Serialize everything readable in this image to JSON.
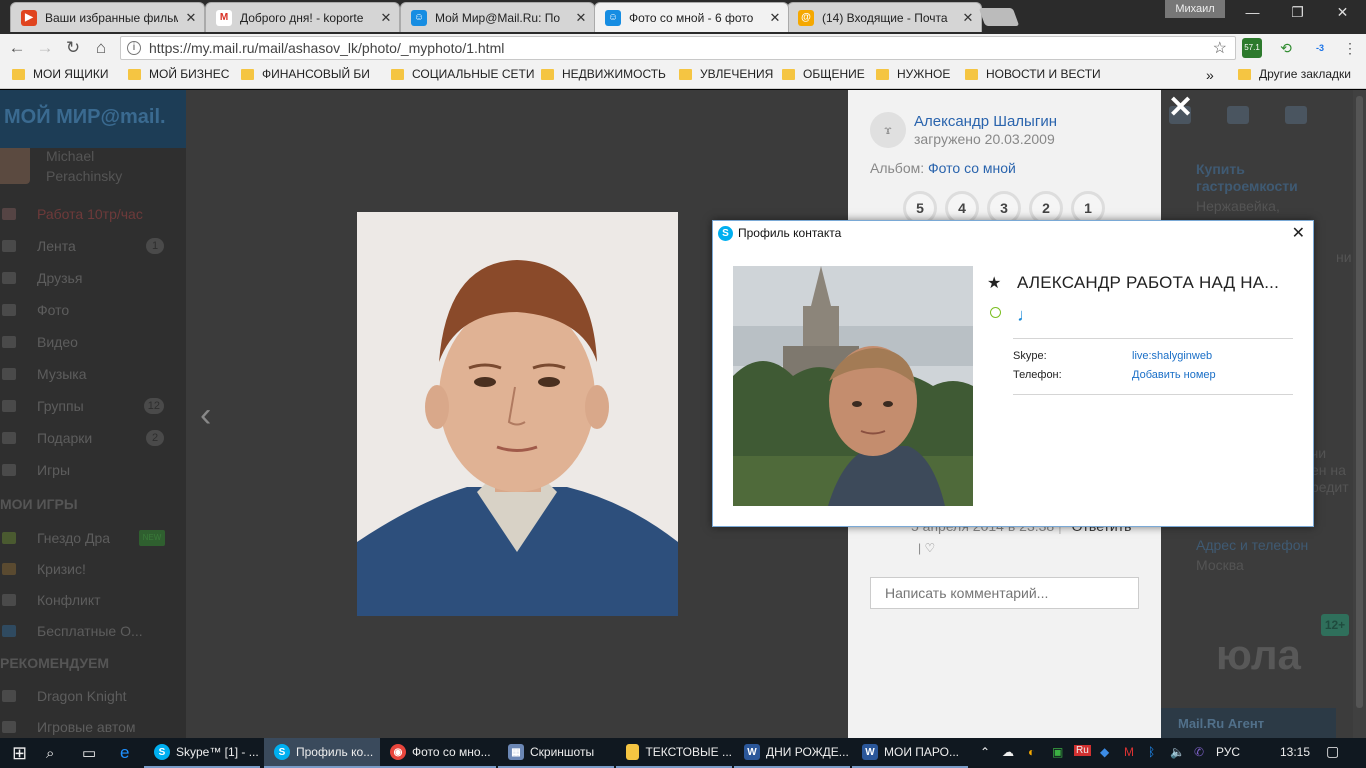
{
  "browser": {
    "tabs": [
      {
        "title": "Ваши избранные фильмы",
        "color": "#e0441f",
        "glyph": "▶"
      },
      {
        "title": "Доброго дня! - koporte",
        "color": "#ffffff",
        "glyph": "M"
      },
      {
        "title": "Мой Мир@Mail.Ru: По",
        "color": "#168de2",
        "glyph": "☺"
      },
      {
        "title": "Фото со мной - 6 фото",
        "color": "#168de2",
        "glyph": "☺"
      },
      {
        "title": "(14) Входящие - Почта",
        "color": "#f5a800",
        "glyph": "@"
      }
    ],
    "window_user": "Михаил",
    "controls": {
      "minimize": "—",
      "maximize": "❐",
      "close": "✕"
    },
    "nav": {
      "back": "←",
      "forward": "→",
      "reload": "↻",
      "home": "⌂"
    },
    "url": "https://my.mail.ru/mail/ashasov_lk/photo/_myphoto/1.html",
    "extensions": {
      "ext1_badge": "57.1",
      "ext3_badge": "-3"
    },
    "bookmarks": [
      "МОИ ЯЩИКИ",
      "МОЙ БИЗНЕС",
      "ФИНАНСОВЫЙ БИ",
      "СОЦИАЛЬНЫЕ СЕТИ",
      "НЕДВИЖИМОСТЬ",
      "УВЛЕЧЕНИЯ",
      "ОБЩЕНИЕ",
      "НУЖНОЕ",
      "НОВОСТИ И ВЕСТИ"
    ],
    "bookmarks_more": "»",
    "other_bookmarks": "Другие закладки"
  },
  "left_nav": {
    "brand": "МОЙ МИР@mail.",
    "user_name_line1": "Michael",
    "user_name_line2": "Perachinsky",
    "promo": "Работа 10тр/час",
    "items": [
      {
        "label": "Лента",
        "count": "1"
      },
      {
        "label": "Друзья",
        "count": ""
      },
      {
        "label": "Фото",
        "count": ""
      },
      {
        "label": "Видео",
        "count": ""
      },
      {
        "label": "Музыка",
        "count": ""
      },
      {
        "label": "Группы",
        "count": "12"
      },
      {
        "label": "Подарки",
        "count": "2"
      },
      {
        "label": "Игры",
        "count": ""
      }
    ],
    "games_header": "МОИ ИГРЫ",
    "games": [
      "Гнездо Дра",
      "Кризис!",
      "Конфликт",
      "Бесплатные О..."
    ],
    "new_badge": "NEW",
    "recommend_header": "РЕКОМЕНДУЕМ",
    "recommend": [
      "Dragon Knight",
      "Игровые автом"
    ]
  },
  "photo_panel": {
    "author": "Александр Шалыгин",
    "uploaded": "загружено 20.03.2009",
    "album_label": "Альбом:",
    "album_name": "Фото со мной",
    "ratings": [
      "5",
      "4",
      "3",
      "2",
      "1"
    ],
    "comment_date": "5 апреля 2014 в 23:38",
    "reply": "Ответить",
    "comment_placeholder": "Написать комментарий...",
    "close": "✕"
  },
  "right_column": {
    "ad_title_1": "Купить",
    "ad_title_2": "гастроемкости",
    "ad_text": "Нержавейка,",
    "ad_text_2": "ни",
    "side_frag_1": "чи",
    "side_frag_2": "ен на",
    "side_frag_3": "редит",
    "address_link": "Адрес и телефон",
    "city": "Москва",
    "yula": "юла",
    "badge": "12+",
    "agent": "Mail.Ru Агент"
  },
  "skype_dialog": {
    "title": "Профиль контакта",
    "close": "✕",
    "contact_name": "АЛЕКСАНДР РАБОТА НАД НА...",
    "mood_icon": "♩",
    "skype_label": "Skype:",
    "skype_value": "live:shalyginweb",
    "phone_label": "Телефон:",
    "phone_value": "Добавить номер"
  },
  "taskbar": {
    "items": [
      {
        "label": "Skype™ [1] - ...",
        "color": "#00aff0",
        "glyph": "S"
      },
      {
        "label": "Профиль ко...",
        "color": "#00aff0",
        "glyph": "S"
      },
      {
        "label": "Фото со мно...",
        "color": "#e8453c",
        "glyph": "◉"
      },
      {
        "label": "Скриншоты",
        "color": "#6b87b5",
        "glyph": "▦"
      },
      {
        "label": "ТЕКСТОВЫЕ ...",
        "color": "#f5c542",
        "glyph": ""
      },
      {
        "label": "ДНИ РОЖДЕ...",
        "color": "#2b579a",
        "glyph": "W"
      },
      {
        "label": "МОИ ПАРО...",
        "color": "#2b579a",
        "glyph": "W"
      }
    ],
    "tray_lang": "РУС",
    "tray_ru": "Ru",
    "clock": "13:15"
  }
}
